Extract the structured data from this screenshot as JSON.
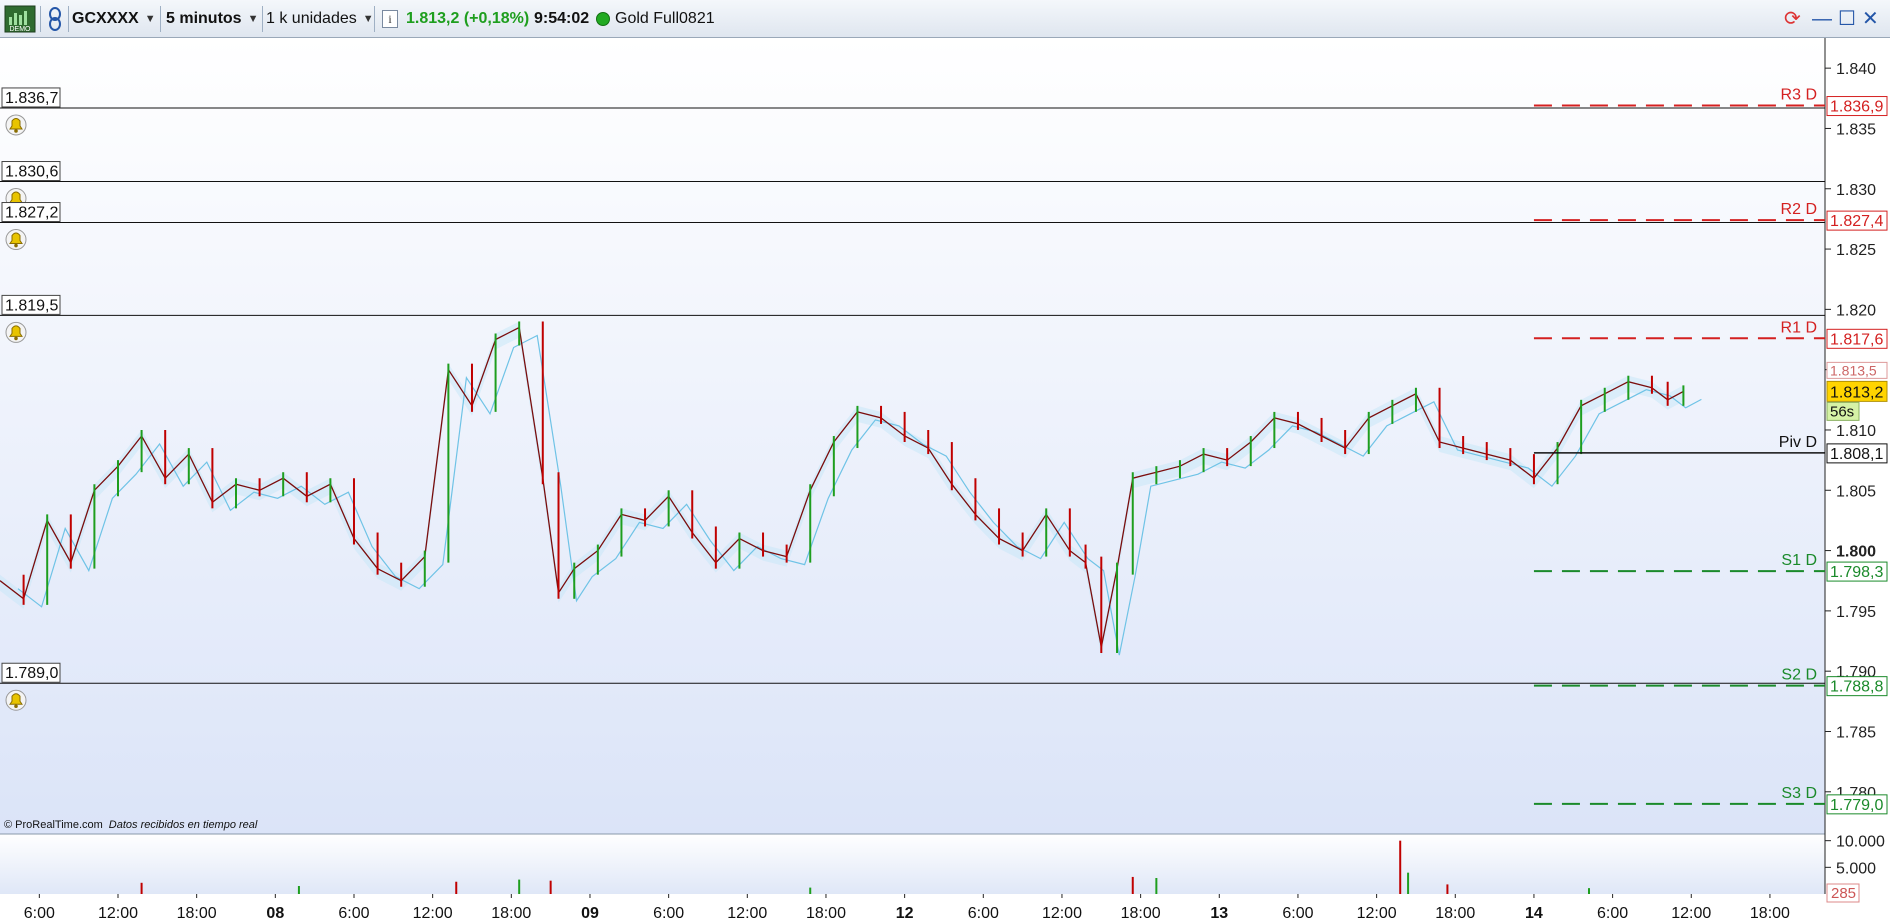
{
  "toolbar": {
    "demo_label": "DEMO",
    "instrument": "GCXXXX",
    "timeframe": "5 minutos",
    "units": "1 k unidades",
    "info_icon": "i",
    "price": "1.813,2",
    "change": "(+0,18%)",
    "time": "9:54:02",
    "contract": "Gold Full0821"
  },
  "colors": {
    "up": "#1e9e1e",
    "down": "#c00000",
    "resistance": "#d42020",
    "support": "#1a8a2a",
    "plot_bg_top": "#ffffff",
    "plot_bg_bottom": "#dbe4f8",
    "price_tag": "#ffd400"
  },
  "chart_data": {
    "type": "line",
    "title": "",
    "ylim": [
      1.7765,
      1.8425
    ],
    "y_ticks": [
      {
        "v": 1.84,
        "label": "1.840"
      },
      {
        "v": 1.835,
        "label": "1.835"
      },
      {
        "v": 1.83,
        "label": "1.830"
      },
      {
        "v": 1.825,
        "label": "1.825"
      },
      {
        "v": 1.82,
        "label": "1.820"
      },
      {
        "v": 1.815,
        "label": "1.815"
      },
      {
        "v": 1.81,
        "label": "1.810"
      },
      {
        "v": 1.805,
        "label": "1.805"
      },
      {
        "v": 1.8,
        "label": "1.800",
        "bold": true
      },
      {
        "v": 1.795,
        "label": "1.795"
      },
      {
        "v": 1.79,
        "label": "1.790"
      },
      {
        "v": 1.785,
        "label": "1.785"
      },
      {
        "v": 1.78,
        "label": "1.780"
      }
    ],
    "x_ticks": [
      {
        "x": 0.5,
        "label": "6:00"
      },
      {
        "x": 1.5,
        "label": "12:00"
      },
      {
        "x": 2.5,
        "label": "18:00"
      },
      {
        "x": 3.5,
        "label": "08",
        "bold": true
      },
      {
        "x": 4.5,
        "label": "6:00"
      },
      {
        "x": 5.5,
        "label": "12:00"
      },
      {
        "x": 6.5,
        "label": "18:00"
      },
      {
        "x": 7.5,
        "label": "09",
        "bold": true
      },
      {
        "x": 8.5,
        "label": "6:00"
      },
      {
        "x": 9.5,
        "label": "12:00"
      },
      {
        "x": 10.5,
        "label": "18:00"
      },
      {
        "x": 11.5,
        "label": "12",
        "bold": true
      },
      {
        "x": 12.5,
        "label": "6:00"
      },
      {
        "x": 13.5,
        "label": "12:00"
      },
      {
        "x": 14.5,
        "label": "18:00"
      },
      {
        "x": 15.5,
        "label": "13",
        "bold": true
      },
      {
        "x": 16.5,
        "label": "6:00"
      },
      {
        "x": 17.5,
        "label": "12:00"
      },
      {
        "x": 18.5,
        "label": "18:00"
      },
      {
        "x": 19.5,
        "label": "14",
        "bold": true
      },
      {
        "x": 20.5,
        "label": "6:00"
      },
      {
        "x": 21.5,
        "label": "12:00"
      },
      {
        "x": 22.5,
        "label": "18:00"
      }
    ],
    "xlim": [
      0,
      23.2
    ],
    "price_series": [
      [
        0.0,
        1.7975
      ],
      [
        0.3,
        1.796
      ],
      [
        0.6,
        1.8025
      ],
      [
        0.9,
        1.799
      ],
      [
        1.2,
        1.805
      ],
      [
        1.5,
        1.807
      ],
      [
        1.8,
        1.8095
      ],
      [
        2.1,
        1.806
      ],
      [
        2.4,
        1.808
      ],
      [
        2.7,
        1.804
      ],
      [
        3.0,
        1.8055
      ],
      [
        3.3,
        1.805
      ],
      [
        3.6,
        1.806
      ],
      [
        3.9,
        1.8045
      ],
      [
        4.2,
        1.8055
      ],
      [
        4.5,
        1.801
      ],
      [
        4.8,
        1.7985
      ],
      [
        5.1,
        1.7975
      ],
      [
        5.4,
        1.7995
      ],
      [
        5.7,
        1.815
      ],
      [
        6.0,
        1.812
      ],
      [
        6.3,
        1.8175
      ],
      [
        6.6,
        1.8185
      ],
      [
        6.9,
        1.806
      ],
      [
        7.1,
        1.7965
      ],
      [
        7.3,
        1.7985
      ],
      [
        7.6,
        1.8
      ],
      [
        7.9,
        1.803
      ],
      [
        8.2,
        1.8025
      ],
      [
        8.5,
        1.8045
      ],
      [
        8.8,
        1.8015
      ],
      [
        9.1,
        1.799
      ],
      [
        9.4,
        1.801
      ],
      [
        9.7,
        1.8
      ],
      [
        10.0,
        1.7995
      ],
      [
        10.3,
        1.805
      ],
      [
        10.6,
        1.809
      ],
      [
        10.9,
        1.8115
      ],
      [
        11.2,
        1.811
      ],
      [
        11.5,
        1.8095
      ],
      [
        11.8,
        1.8085
      ],
      [
        12.1,
        1.8055
      ],
      [
        12.4,
        1.803
      ],
      [
        12.7,
        1.801
      ],
      [
        13.0,
        1.8
      ],
      [
        13.3,
        1.803
      ],
      [
        13.6,
        1.8
      ],
      [
        13.8,
        1.799
      ],
      [
        14.0,
        1.792
      ],
      [
        14.2,
        1.7985
      ],
      [
        14.4,
        1.806
      ],
      [
        14.7,
        1.8065
      ],
      [
        15.0,
        1.807
      ],
      [
        15.3,
        1.808
      ],
      [
        15.6,
        1.8075
      ],
      [
        15.9,
        1.809
      ],
      [
        16.2,
        1.811
      ],
      [
        16.5,
        1.8105
      ],
      [
        16.8,
        1.8095
      ],
      [
        17.1,
        1.8085
      ],
      [
        17.4,
        1.811
      ],
      [
        17.7,
        1.812
      ],
      [
        18.0,
        1.813
      ],
      [
        18.3,
        1.809
      ],
      [
        18.6,
        1.8085
      ],
      [
        18.9,
        1.808
      ],
      [
        19.2,
        1.8075
      ],
      [
        19.5,
        1.806
      ],
      [
        19.8,
        1.8085
      ],
      [
        20.1,
        1.812
      ],
      [
        20.4,
        1.813
      ],
      [
        20.7,
        1.814
      ],
      [
        21.0,
        1.8135
      ],
      [
        21.2,
        1.8125
      ],
      [
        21.4,
        1.8132
      ]
    ],
    "series": [
      {
        "name": "R3 D",
        "value": 1.8369,
        "label": "1.836,9",
        "role": "resistance"
      },
      {
        "name": "R2 D",
        "value": 1.8274,
        "label": "1.827,4",
        "role": "resistance"
      },
      {
        "name": "R1 D",
        "value": 1.8176,
        "label": "1.817,6",
        "role": "resistance"
      },
      {
        "name": "Piv D",
        "value": 1.8081,
        "label": "1.808,1",
        "role": "pivot"
      },
      {
        "name": "S1 D",
        "value": 1.7983,
        "label": "1.798,3",
        "role": "support"
      },
      {
        "name": "S2 D",
        "value": 1.7888,
        "label": "1.788,8",
        "role": "support"
      },
      {
        "name": "S3 D",
        "value": 1.779,
        "label": "1.779,0",
        "role": "support"
      }
    ],
    "alert_lines": [
      {
        "value": 1.8367,
        "label": "1.836,7"
      },
      {
        "value": 1.8306,
        "label": "1.830,6"
      },
      {
        "value": 1.8272,
        "label": "1.827,2"
      },
      {
        "value": 1.8195,
        "label": "1.819,5"
      },
      {
        "value": 1.789,
        "label": "1.789,0"
      }
    ],
    "current_price": {
      "value": 1.8132,
      "label": "1.813,2"
    },
    "countdown": "56s",
    "high_tag": "1.813,5",
    "volume": {
      "ylim": [
        0,
        10500
      ],
      "y_ticks": [
        {
          "v": 10000,
          "label": "10.000"
        },
        {
          "v": 5000,
          "label": "5.000"
        }
      ],
      "last_value": "285",
      "spikes": [
        [
          1.8,
          2100
        ],
        [
          3.8,
          1500
        ],
        [
          5.8,
          2300
        ],
        [
          6.6,
          2700
        ],
        [
          7.0,
          2500
        ],
        [
          10.3,
          1200
        ],
        [
          14.4,
          3200
        ],
        [
          14.7,
          3000
        ],
        [
          17.8,
          10000
        ],
        [
          17.9,
          4000
        ],
        [
          18.4,
          1800
        ],
        [
          20.2,
          1100
        ]
      ]
    }
  },
  "footer": {
    "copyright": "© ProRealTime.com",
    "realtime": "Datos recibidos en tiempo real"
  }
}
